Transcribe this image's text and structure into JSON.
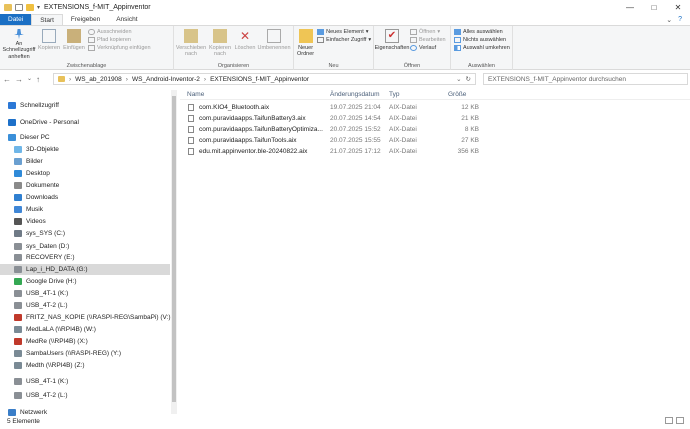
{
  "window": {
    "title": "EXTENSIONS_f-MIT_Appinventor",
    "minimize": "—",
    "maximize": "□",
    "close": "✕"
  },
  "tabs": [
    "Datei",
    "Start",
    "Freigeben",
    "Ansicht"
  ],
  "help_glyph": "?",
  "ribbon": {
    "clipboard": {
      "label": "Zwischenablage",
      "pin": "An Schnellzugriff anheften",
      "copy": "Kopieren",
      "paste": "Einfügen",
      "cut": "Ausschneiden",
      "copy_path": "Pfad kopieren",
      "paste_link": "Verknüpfung einfügen"
    },
    "organize": {
      "label": "Organisieren",
      "move": "Verschieben nach",
      "copy_to": "Kopieren nach",
      "delete": "Löschen",
      "rename": "Umbenennen"
    },
    "new": {
      "label": "Neu",
      "new_folder": "Neuer Ordner",
      "new_item": "Neues Element",
      "easy_access": "Einfacher Zugriff"
    },
    "open": {
      "label": "Öffnen",
      "properties": "Eigenschaften",
      "open": "Öffnen",
      "edit": "Bearbeiten",
      "history": "Verlauf"
    },
    "select": {
      "label": "Auswählen",
      "all": "Alles auswählen",
      "none": "Nichts auswählen",
      "invert": "Auswahl umkehren"
    }
  },
  "address": {
    "crumbs": [
      "WS_ab_201908",
      "WS_Android-Inventor-2",
      "EXTENSIONS_f-MIT_Appinventor"
    ],
    "search_placeholder": "EXTENSIONS_f-MIT_Appinventor durchsuchen"
  },
  "sidebar": [
    {
      "label": "Schnellzugriff",
      "icon": "star-icon",
      "color": "#2b78d6"
    },
    {
      "label": "OneDrive - Personal",
      "icon": "cloud-icon",
      "color": "#1d70c9"
    },
    {
      "label": "Dieser PC",
      "icon": "pc-icon",
      "color": "#3a8fd9"
    },
    {
      "label": "3D-Objekte",
      "icon": "cube-icon",
      "color": "#6fb6e8"
    },
    {
      "label": "Bilder",
      "icon": "pictures-icon",
      "color": "#6a9fd0"
    },
    {
      "label": "Desktop",
      "icon": "desktop-icon",
      "color": "#2f8ad8"
    },
    {
      "label": "Dokumente",
      "icon": "documents-icon",
      "color": "#8a8a8a"
    },
    {
      "label": "Downloads",
      "icon": "download-icon",
      "color": "#2f7fd0"
    },
    {
      "label": "Musik",
      "icon": "music-icon",
      "color": "#3f86d6"
    },
    {
      "label": "Videos",
      "icon": "video-icon",
      "color": "#555555"
    },
    {
      "label": "sys_SYS (C:)",
      "icon": "drive-icon",
      "color": "#6f7a86"
    },
    {
      "label": "sys_Daten (D:)",
      "icon": "drive-icon",
      "color": "#8a8f95"
    },
    {
      "label": "RECOVERY (E:)",
      "icon": "drive-icon",
      "color": "#8a8f95"
    },
    {
      "label": "Lap_i_HD_DATA (G:)",
      "icon": "drive-icon",
      "color": "#8a8f95"
    },
    {
      "label": "Google Drive (H:)",
      "icon": "google-drive-icon",
      "color": "#34a853"
    },
    {
      "label": "USB_4T-1 (K:)",
      "icon": "usb-drive-icon",
      "color": "#8a8f95"
    },
    {
      "label": "USB_4T-2 (L:)",
      "icon": "usb-drive-icon",
      "color": "#8a8f95"
    },
    {
      "label": "FRITZ_NAS_KOPIE (\\\\RASPI-REG\\SambaPi) (V:)",
      "icon": "network-drive-icon",
      "color": "#c0392b"
    },
    {
      "label": "MedLaLA (\\\\RPI4B) (W:)",
      "icon": "network-drive-icon",
      "color": "#7a8a95"
    },
    {
      "label": "MedRe (\\\\RPI4B) (X:)",
      "icon": "network-drive-icon",
      "color": "#c0392b"
    },
    {
      "label": "SambaUsers (\\\\RASPI-REG) (Y:)",
      "icon": "network-drive-icon",
      "color": "#7a8a95"
    },
    {
      "label": "Medth (\\\\RPI4B) (Z:)",
      "icon": "network-drive-icon",
      "color": "#7a8a95"
    },
    {
      "label": "USB_4T-1 (K:)",
      "icon": "usb-drive-icon",
      "color": "#8a8f95"
    },
    {
      "label": "USB_4T-2 (L:)",
      "icon": "usb-drive-icon",
      "color": "#8a8f95"
    },
    {
      "label": "Netzwerk",
      "icon": "network-icon",
      "color": "#3a7ec8"
    }
  ],
  "columns": {
    "name": "Name",
    "date": "Änderungsdatum",
    "type": "Typ",
    "size": "Größe"
  },
  "files": [
    {
      "name": "com.KIO4_Bluetooth.aix",
      "date": "19.07.2025 21:04",
      "type": "AIX-Datei",
      "size": "12 KB"
    },
    {
      "name": "com.puravidaapps.TaifunBattery3.aix",
      "date": "20.07.2025 14:54",
      "type": "AIX-Datei",
      "size": "21 KB"
    },
    {
      "name": "com.puravidaapps.TaifunBatteryOptimiza...",
      "date": "20.07.2025 15:52",
      "type": "AIX-Datei",
      "size": "8 KB"
    },
    {
      "name": "com.puravidaapps.TaifunTools.aix",
      "date": "20.07.2025 15:55",
      "type": "AIX-Datei",
      "size": "27 KB"
    },
    {
      "name": "edu.mit.appinventor.ble-20240822.aix",
      "date": "21.07.2025 17:12",
      "type": "AIX-Datei",
      "size": "356 KB"
    }
  ],
  "status": {
    "count": "5 Elemente"
  }
}
